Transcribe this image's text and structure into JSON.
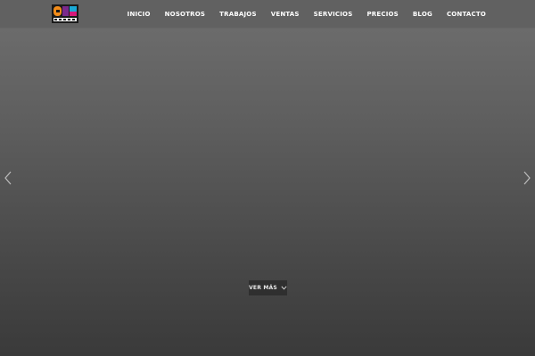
{
  "brand": {
    "logo_icon": "brand-logo-icon",
    "colors": {
      "orange": "#f28c1a",
      "purple": "#7a2a8c",
      "magenta": "#d6197a",
      "cyan": "#1aa9d6"
    }
  },
  "nav": {
    "items": [
      {
        "label": "INICIO"
      },
      {
        "label": "NOSOTROS"
      },
      {
        "label": "TRABAJOS"
      },
      {
        "label": "VENTAS"
      },
      {
        "label": "SERVICIOS"
      },
      {
        "label": "PRECIOS"
      },
      {
        "label": "BLOG"
      },
      {
        "label": "CONTACTO"
      }
    ]
  },
  "slider": {
    "prev_icon": "chevron-left-icon",
    "next_icon": "chevron-right-icon"
  },
  "cta": {
    "label": "VER MÁS",
    "icon": "chevron-down-icon"
  }
}
